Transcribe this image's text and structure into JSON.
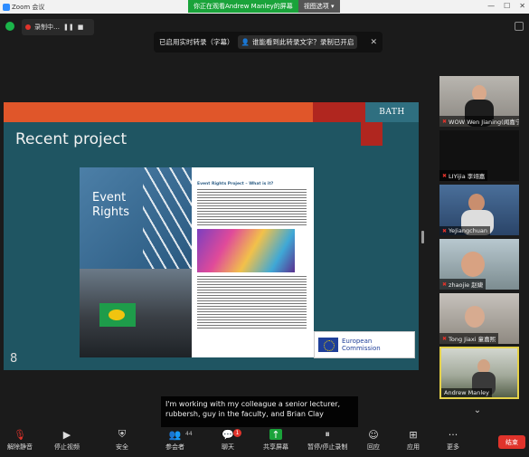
{
  "window": {
    "title": "Zoom 会议",
    "share_banner": "你正在观看Andrew Manley的屏幕",
    "view_options": "视图选项 ▾",
    "controls": [
      "—",
      "☐",
      "✕"
    ]
  },
  "meeting_top": {
    "recording_label": "录制中…",
    "recording_pause": "❚❚",
    "recording_stop": "■"
  },
  "transcript_bar": {
    "status": "已启用实时转录（字幕）",
    "prompt": "谁能看到此转录文字？录制已开启",
    "close": "✕"
  },
  "slide": {
    "university": "BATH",
    "title": "Recent project",
    "page_number": "8",
    "brochure": {
      "cover_title_line1": "Event",
      "cover_title_line2": "Rights",
      "page_title": "Event Rights Project – What is it?"
    },
    "eu_logo": {
      "line1": "European",
      "line2": "Commission"
    }
  },
  "participants": [
    {
      "name": "WOW Wen Jianing(闻嘉宁)",
      "muted": true
    },
    {
      "name": "LIYijia 李翊嘉",
      "muted": true
    },
    {
      "name": "YeJiangchuan",
      "muted": true
    },
    {
      "name": "zhaojie 赵婕",
      "muted": true
    },
    {
      "name": "Tong Jiaxi 童嘉熙",
      "muted": true
    },
    {
      "name": "Andrew Manley",
      "muted": false
    }
  ],
  "caption": {
    "text": "I'm working with my colleague a senior lecturer, rubbersh, guy in the faculty, and Brian Clay"
  },
  "toolbar": {
    "unmute": "解除静音",
    "stop_video": "停止视频",
    "security": "安全",
    "participants": "参会者",
    "participants_count": "44",
    "chat": "聊天",
    "chat_badge": "1",
    "share_screen": "共享屏幕",
    "pause_recording": "暂停/停止录制",
    "reactions": "回应",
    "apps": "应用",
    "more": "更多",
    "end": "结束"
  }
}
